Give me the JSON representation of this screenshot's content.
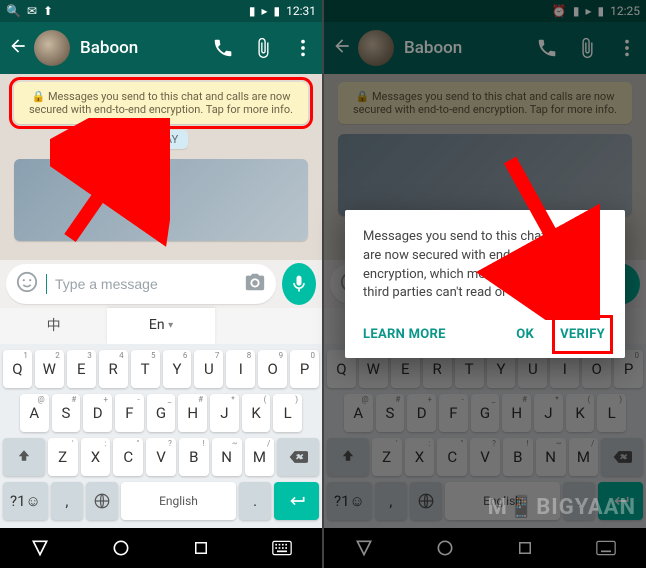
{
  "status": {
    "time_left": "12:31",
    "time_right": "12:25"
  },
  "contact": {
    "name": "Baboon"
  },
  "chat": {
    "encryption_text": "🔒 Messages you send to this chat and calls are now secured with end-to-end encryption. Tap for more info.",
    "date_label": "TODAY"
  },
  "input": {
    "placeholder": "Type a message"
  },
  "dialog": {
    "body": "Messages you send to this chat and calls are now secured with end-to-end encryption, which means WhatsApp and third parties can't read or listen to them.",
    "learn_more": "LEARN MORE",
    "ok": "OK",
    "verify": "VERIFY"
  },
  "keyboard": {
    "tabs": {
      "lang1": "中",
      "lang2": "En",
      "dropdown": "▾"
    },
    "row1": [
      {
        "m": "Q",
        "s": "1"
      },
      {
        "m": "W",
        "s": "2"
      },
      {
        "m": "E",
        "s": "3"
      },
      {
        "m": "R",
        "s": "4"
      },
      {
        "m": "T",
        "s": "5"
      },
      {
        "m": "Y",
        "s": "6"
      },
      {
        "m": "U",
        "s": "7"
      },
      {
        "m": "I",
        "s": "8"
      },
      {
        "m": "O",
        "s": "9"
      },
      {
        "m": "P",
        "s": "0"
      }
    ],
    "row2": [
      {
        "m": "A",
        "s": "@"
      },
      {
        "m": "S",
        "s": "#"
      },
      {
        "m": "D",
        "s": "+"
      },
      {
        "m": "F",
        "s": "-"
      },
      {
        "m": "G",
        "s": "_"
      },
      {
        "m": "H",
        "s": "#"
      },
      {
        "m": "J",
        "s": "*"
      },
      {
        "m": "K",
        "s": "("
      },
      {
        "m": "L",
        "s": ")"
      }
    ],
    "row3": [
      {
        "m": "Z",
        "s": "'"
      },
      {
        "m": "X",
        "s": ":"
      },
      {
        "m": "C",
        "s": "\""
      },
      {
        "m": "V",
        "s": "?"
      },
      {
        "m": "B",
        "s": "!"
      },
      {
        "m": "N",
        "s": "~"
      },
      {
        "m": "M",
        "s": "/"
      }
    ],
    "bottom": {
      "sym": "?1☺",
      "space": "English",
      "period": ".",
      "comma": ","
    }
  },
  "watermark": "M📱BIGYAAN"
}
